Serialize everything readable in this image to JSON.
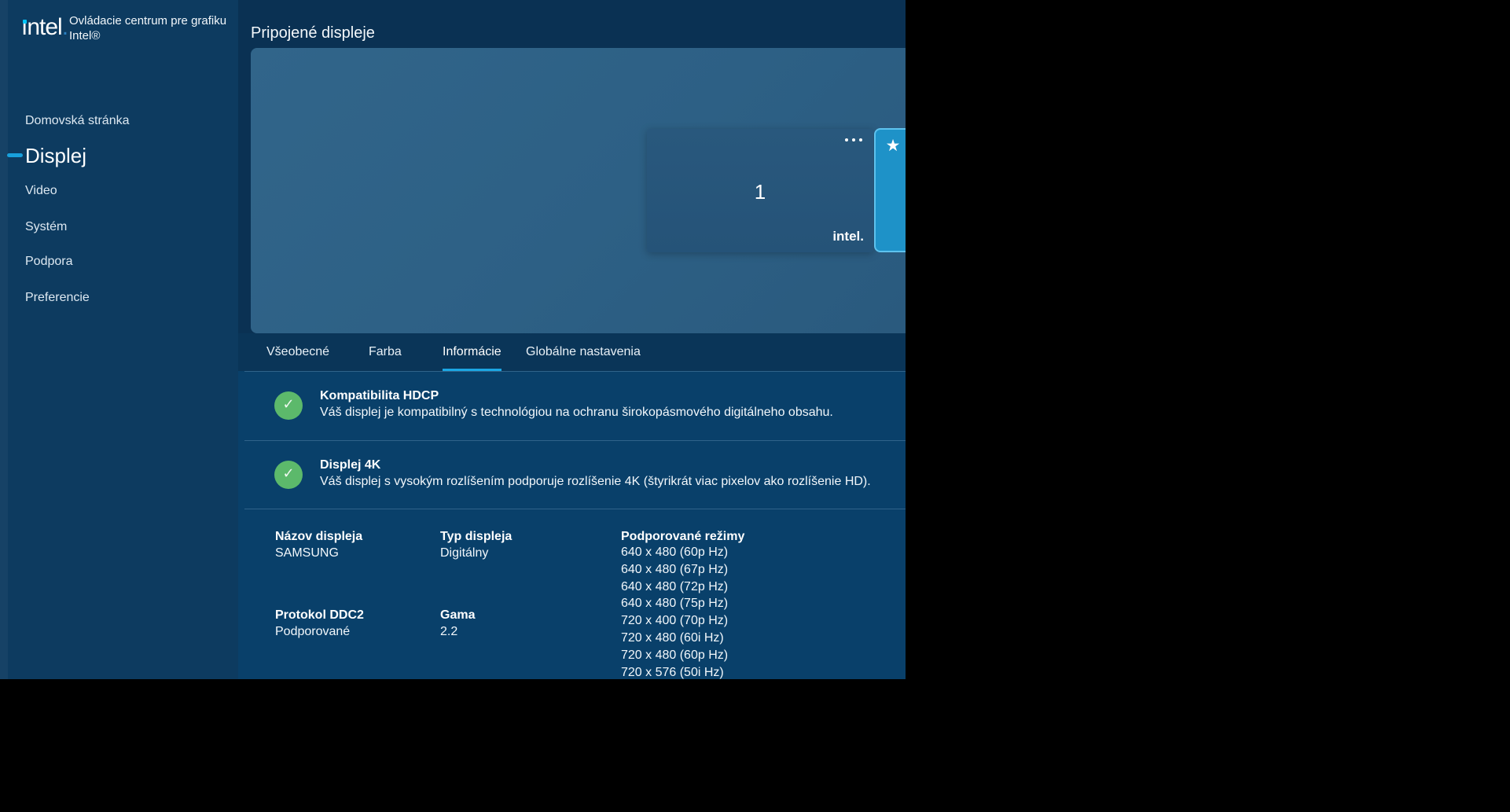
{
  "app": {
    "logo_text": "intel",
    "title_line1": "Ovládacie centrum pre grafiku",
    "title_line2": "Intel®"
  },
  "sidebar": {
    "items": [
      {
        "label": "Domovská stránka",
        "selected": false
      },
      {
        "label": "Displej",
        "selected": true
      },
      {
        "label": "Video",
        "selected": false
      },
      {
        "label": "Systém",
        "selected": false
      },
      {
        "label": "Podpora",
        "selected": false
      },
      {
        "label": "Preferencie",
        "selected": false
      }
    ]
  },
  "main": {
    "heading": "Pripojené displeje",
    "display_tile": {
      "number": "1",
      "brand": "intel.",
      "menu_icon": "ellipsis-icon",
      "favorite_icon": "star-icon",
      "star_glyph": "★"
    },
    "tabs": [
      {
        "label": "Všeobecné",
        "selected": false
      },
      {
        "label": "Farba",
        "selected": false
      },
      {
        "label": "Informácie",
        "selected": true
      },
      {
        "label": "Globálne nastavenia",
        "selected": false
      }
    ],
    "sections": [
      {
        "icon": "check-icon",
        "check_glyph": "✓",
        "title": "Kompatibilita HDCP",
        "description": "Váš displej je kompatibilný s technológiou na ochranu širokopásmového digitálneho obsahu."
      },
      {
        "icon": "check-icon",
        "check_glyph": "✓",
        "title": "Displej 4K",
        "description": "Váš displej s vysokým rozlíšením podporuje rozlíšenie 4K (štyrikrát viac pixelov ako rozlíšenie HD)."
      }
    ],
    "details": {
      "fields": [
        {
          "label": "Názov displeja",
          "value": "SAMSUNG"
        },
        {
          "label": "Typ displeja",
          "value": "Digitálny"
        },
        {
          "label": "Protokol DDC2",
          "value": "Podporované"
        },
        {
          "label": "Gama",
          "value": "2.2"
        }
      ],
      "modes_label": "Podporované režimy",
      "modes": [
        "640 x 480 (60p Hz)",
        "640 x 480 (67p Hz)",
        "640 x 480 (72p Hz)",
        "640 x 480 (75p Hz)",
        "720 x 400 (70p Hz)",
        "720 x 480 (60i Hz)",
        "720 x 480 (60p Hz)",
        "720 x 576 (50i Hz)"
      ]
    }
  },
  "colors": {
    "accent_cyan": "#18a0dc",
    "tab_underline": "#1ba6e3",
    "success_green": "#5cb96b",
    "star_button_fill": "#1e92c8",
    "star_button_border": "#5ec2ee",
    "sidebar_bg": "#0d3b60",
    "content_bg": "#09406a",
    "preview_bg": "#2d6085",
    "logo_dot": "#04c7fd"
  }
}
